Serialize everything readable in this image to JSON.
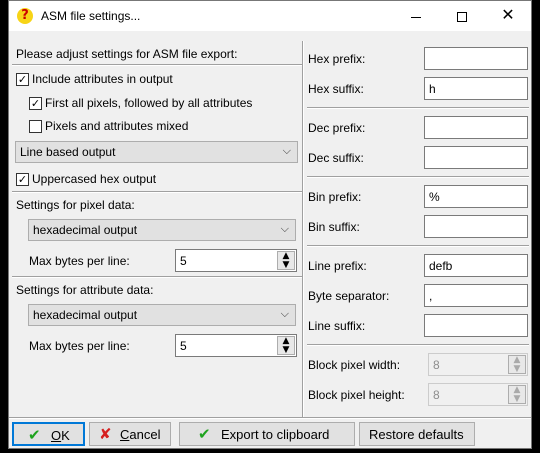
{
  "window": {
    "title": "ASM file settings...",
    "icon": "question-icon",
    "controls": {
      "minimize": "minimize-icon",
      "maximize": "maximize-icon",
      "close": "✕"
    }
  },
  "left": {
    "intro": "Please adjust settings for ASM file export:",
    "include_attributes": {
      "label": "Include attributes in output",
      "checked": true
    },
    "first_pixels": {
      "label": "First all pixels, followed by all attributes",
      "checked": true
    },
    "mixed": {
      "label": "Pixels and attributes mixed",
      "checked": false
    },
    "output_mode": "Line based output",
    "uppercased": {
      "label": "Uppercased hex output",
      "checked": true
    },
    "pixel_section": "Settings for pixel data:",
    "pixel_format": "hexadecimal output",
    "pixel_max_label": "Max bytes per line:",
    "pixel_max_value": "5",
    "attr_section": "Settings for attribute data:",
    "attr_format": "hexadecimal output",
    "attr_max_label": "Max bytes per line:",
    "attr_max_value": "5"
  },
  "right": {
    "hex_prefix": {
      "label": "Hex prefix:",
      "value": ""
    },
    "hex_suffix": {
      "label": "Hex suffix:",
      "value": "h"
    },
    "dec_prefix": {
      "label": "Dec prefix:",
      "value": ""
    },
    "dec_suffix": {
      "label": "Dec suffix:",
      "value": ""
    },
    "bin_prefix": {
      "label": "Bin prefix:",
      "value": "%"
    },
    "bin_suffix": {
      "label": "Bin suffix:",
      "value": ""
    },
    "line_prefix": {
      "label": "Line prefix:",
      "value": "defb"
    },
    "byte_separator": {
      "label": "Byte separator:",
      "value": ","
    },
    "line_suffix": {
      "label": "Line suffix:",
      "value": ""
    },
    "block_width": {
      "label": "Block pixel width:",
      "value": "8"
    },
    "block_height": {
      "label": "Block pixel height:",
      "value": "8"
    }
  },
  "buttons": {
    "ok_underline": "O",
    "ok_rest": "K",
    "cancel_underline": "C",
    "cancel_rest": "ancel",
    "export": "Export to clipboard",
    "restore": "Restore defaults"
  }
}
